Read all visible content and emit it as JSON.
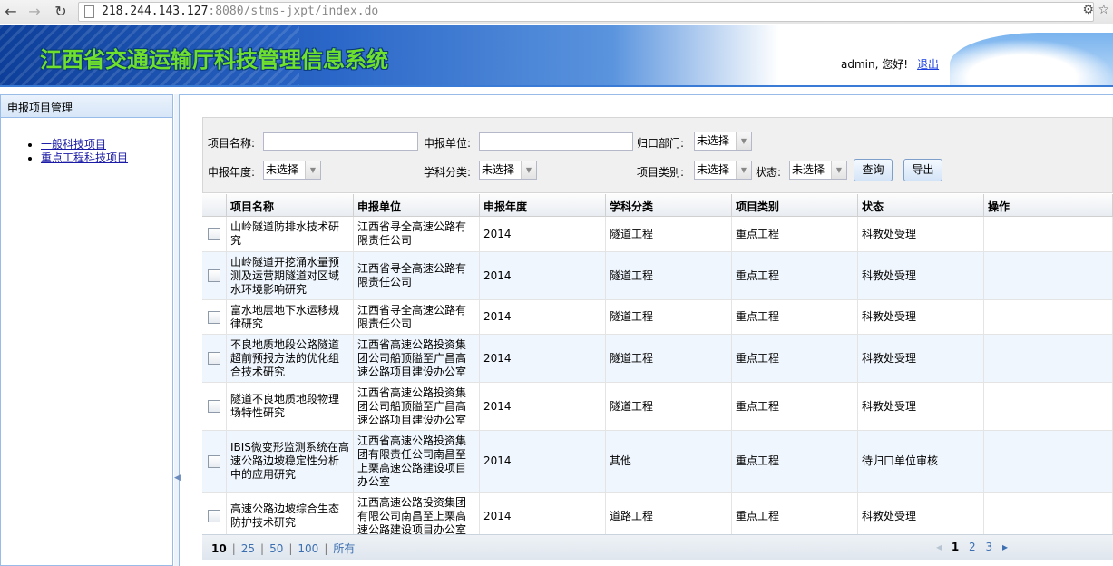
{
  "browser": {
    "url_host": "218.244.143.127",
    "url_port": ":8080",
    "url_path": "/stms-jxpt/index.do"
  },
  "header": {
    "title": "江西省交通运输厅科技管理信息系统",
    "greeting": "admin, 您好!",
    "logout": "退出"
  },
  "sidebar": {
    "title": "申报项目管理",
    "items": [
      {
        "label": "一般科技项目"
      },
      {
        "label": "重点工程科技项目"
      }
    ]
  },
  "search": {
    "project_name_label": "项目名称:",
    "unit_label": "申报单位:",
    "dept_label": "归口部门:",
    "dept_value": "未选择",
    "year_label": "申报年度:",
    "year_value": "未选择",
    "subject_label": "学科分类:",
    "subject_value": "未选择",
    "category_label": "项目类别:",
    "category_value": "未选择",
    "status_label": "状态:",
    "status_value": "未选择",
    "query_button": "查询",
    "export_button": "导出"
  },
  "grid": {
    "columns": [
      "项目名称",
      "申报单位",
      "申报年度",
      "学科分类",
      "项目类别",
      "状态",
      "操作"
    ],
    "rows": [
      {
        "name": "山岭隧道防排水技术研究",
        "unit": "江西省寻全高速公路有限责任公司",
        "year": "2014",
        "subject": "隧道工程",
        "category": "重点工程",
        "status": "科教处受理",
        "op": ""
      },
      {
        "name": "山岭隧道开挖涌水量预测及运营期隧道对区域水环境影响研究",
        "unit": "江西省寻全高速公路有限责任公司",
        "year": "2014",
        "subject": "隧道工程",
        "category": "重点工程",
        "status": "科教处受理",
        "op": ""
      },
      {
        "name": "富水地层地下水运移规律研究",
        "unit": "江西省寻全高速公路有限责任公司",
        "year": "2014",
        "subject": "隧道工程",
        "category": "重点工程",
        "status": "科教处受理",
        "op": ""
      },
      {
        "name": "不良地质地段公路隧道超前预报方法的优化组合技术研究",
        "unit": "江西省高速公路投资集团公司船顶隘至广昌高速公路项目建设办公室",
        "year": "2014",
        "subject": "隧道工程",
        "category": "重点工程",
        "status": "科教处受理",
        "op": ""
      },
      {
        "name": "隧道不良地质地段物理场特性研究",
        "unit": "江西省高速公路投资集团公司船顶隘至广昌高速公路项目建设办公室",
        "year": "2014",
        "subject": "隧道工程",
        "category": "重点工程",
        "status": "科教处受理",
        "op": ""
      },
      {
        "name": "IBIS微变形监测系统在高速公路边坡稳定性分析中的应用研究",
        "unit": "江西省高速公路投资集团有限责任公司南昌至上栗高速公路建设项目办公室",
        "year": "2014",
        "subject": "其他",
        "category": "重点工程",
        "status": "待归口单位审核",
        "op": ""
      },
      {
        "name": "高速公路边坡综合生态防护技术研究",
        "unit": "江西高速公路投资集团有限公司南昌至上栗高速公路建设项目办公室",
        "year": "2014",
        "subject": "道路工程",
        "category": "重点工程",
        "status": "科教处受理",
        "op": ""
      }
    ]
  },
  "pager": {
    "sizes": [
      "10",
      "25",
      "50",
      "100",
      "所有"
    ],
    "selected_size": "10",
    "pages": [
      "1",
      "2",
      "3"
    ],
    "current_page": "1"
  }
}
